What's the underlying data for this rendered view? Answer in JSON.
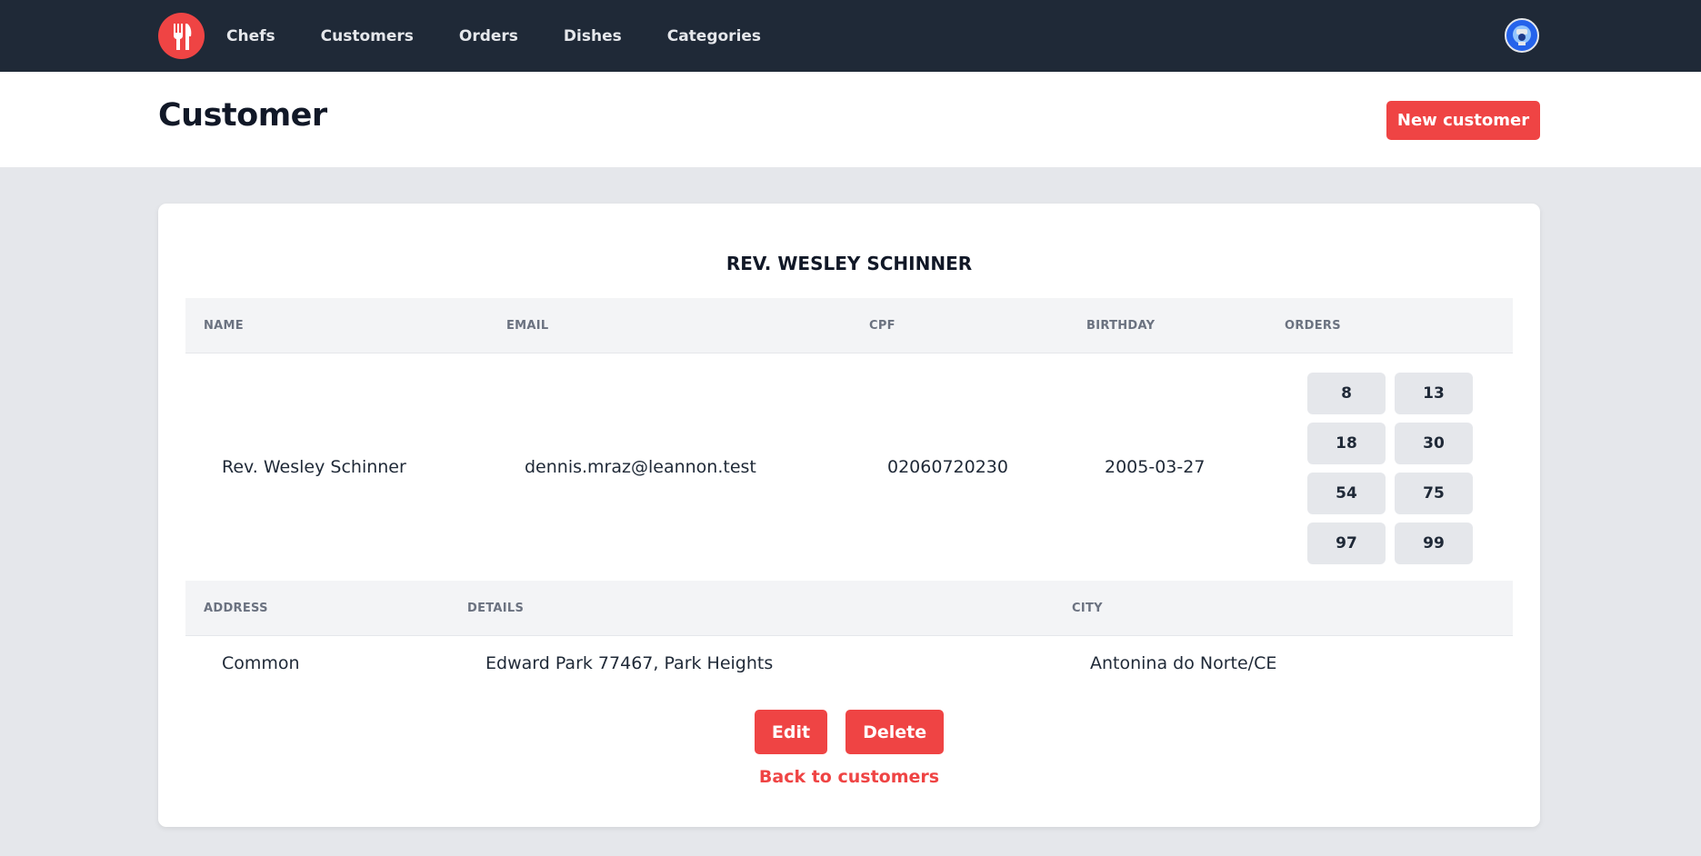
{
  "nav": {
    "links": [
      "Chefs",
      "Customers",
      "Orders",
      "Dishes",
      "Categories"
    ]
  },
  "header": {
    "title": "Customer",
    "new_button": "New customer"
  },
  "customer": {
    "heading": "REV. WESLEY SCHINNER",
    "columns": [
      "NAME",
      "EMAIL",
      "CPF",
      "BIRTHDAY",
      "ORDERS"
    ],
    "name": "Rev. Wesley Schinner",
    "email": "dennis.mraz@leannon.test",
    "cpf": "02060720230",
    "birthday": "2005-03-27",
    "orders": [
      "8",
      "13",
      "18",
      "30",
      "54",
      "75",
      "97",
      "99"
    ],
    "address_columns": [
      "ADDRESS",
      "DETAILS",
      "CITY"
    ],
    "address": "Common",
    "details": "Edward Park 77467, Park Heights",
    "city": "Antonina do Norte/CE"
  },
  "actions": {
    "edit": "Edit",
    "delete": "Delete",
    "back": "Back to customers"
  },
  "colors": {
    "navbar": "#1f2937",
    "accent": "#ef4444",
    "background": "#e5e7eb"
  }
}
